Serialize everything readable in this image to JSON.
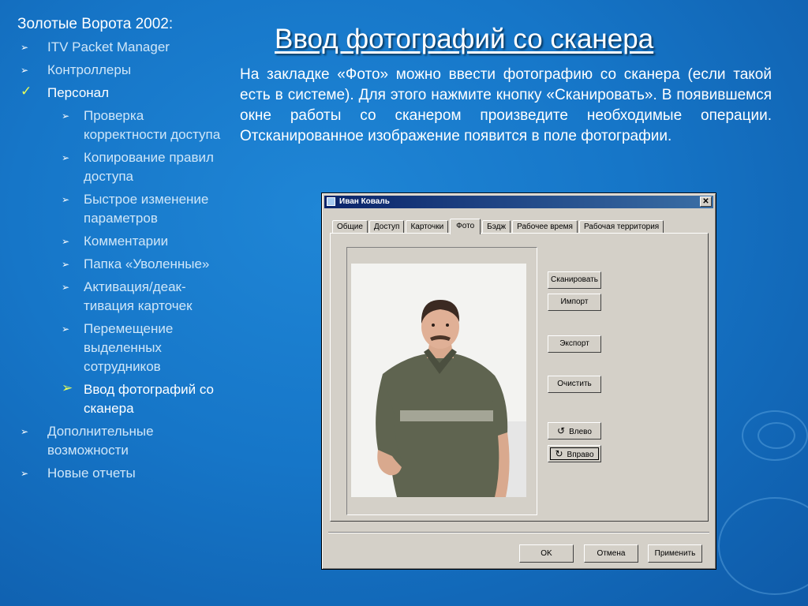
{
  "sidebar": {
    "title": "Золотые Ворота 2002:",
    "items": [
      {
        "label": "ITV Packet Manager"
      },
      {
        "label": "Контроллеры"
      },
      {
        "label": "Персонал"
      }
    ],
    "subitems": [
      {
        "label": "Проверка корректности доступа"
      },
      {
        "label": "Копирование правил доступа"
      },
      {
        "label": "Быстрое изменение параметров"
      },
      {
        "label": "Комментарии"
      },
      {
        "label": "Папка «Уволенные»"
      },
      {
        "label": "Активация/деак-тивация карточек"
      },
      {
        "label": "Перемещение выделенных сотрудников"
      },
      {
        "label": "Ввод фотографий со сканера"
      }
    ],
    "items_after": [
      {
        "label": "Дополнительные возможности"
      },
      {
        "label": "Новые отчеты"
      }
    ]
  },
  "slide": {
    "title": "Ввод фотографий со сканера",
    "text": "На закладке «Фото» можно ввести фотографию со сканера (если такой есть в системе). Для этого нажмите кнопку «Сканировать». В появившемся окне работы со сканером произведите необходимые операции. Отсканированное изображение появится в поле фотографии."
  },
  "dialog": {
    "title": "Иван Коваль",
    "tabs": [
      "Общие",
      "Доступ",
      "Карточки",
      "Фото",
      "Бэдж",
      "Рабочее время",
      "Рабочая территория"
    ],
    "active_tab": "Фото",
    "buttons": {
      "scan": "Сканировать",
      "import": "Импорт",
      "export": "Экспорт",
      "clear": "Очистить",
      "rotate_left": "Влево",
      "rotate_right": "Вправо"
    },
    "footer": {
      "ok": "OK",
      "cancel": "Отмена",
      "apply": "Применить"
    }
  },
  "colors": {
    "background": "#1676c8",
    "current_bullet": "#e8ff5a",
    "titlebar": "#0a246a"
  },
  "icons": {
    "bullet": "arrow-bullet-icon",
    "current_bullet": "check-bullet-icon",
    "rotate_left": "rotate-ccw-icon",
    "rotate_right": "rotate-cw-icon"
  }
}
